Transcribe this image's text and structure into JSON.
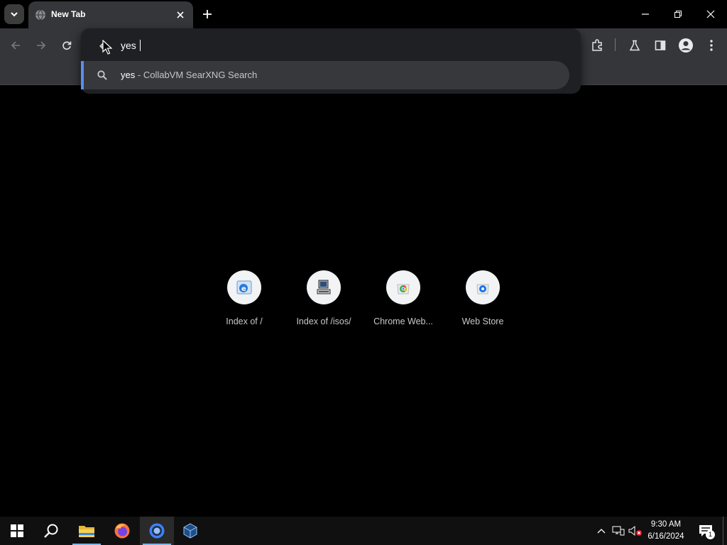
{
  "browser": {
    "tab_title": "New Tab",
    "omnibox_text": "yes",
    "suggestion": {
      "query": "yes",
      "separator": "-",
      "provider": "CollabVM SearXNG Search"
    }
  },
  "shortcuts": [
    {
      "label": "Index of /",
      "icon": "internet-explorer-icon"
    },
    {
      "label": "Index of /isos/",
      "icon": "computer-icon"
    },
    {
      "label": "Chrome Web...",
      "icon": "chrome-web-store-icon"
    },
    {
      "label": "Web Store",
      "icon": "web-store-icon"
    }
  ],
  "taskbar": {
    "pinned": [
      "start-icon",
      "search-icon",
      "file-explorer-icon",
      "firefox-icon",
      "chrome-icon",
      "virtualbox-icon"
    ],
    "time": "9:30 AM",
    "date": "6/16/2024",
    "notification_count": "1"
  },
  "colors": {
    "accent": "#5b8def",
    "toolbar": "#35363a",
    "background": "#000000",
    "taskbar": "#101010"
  }
}
